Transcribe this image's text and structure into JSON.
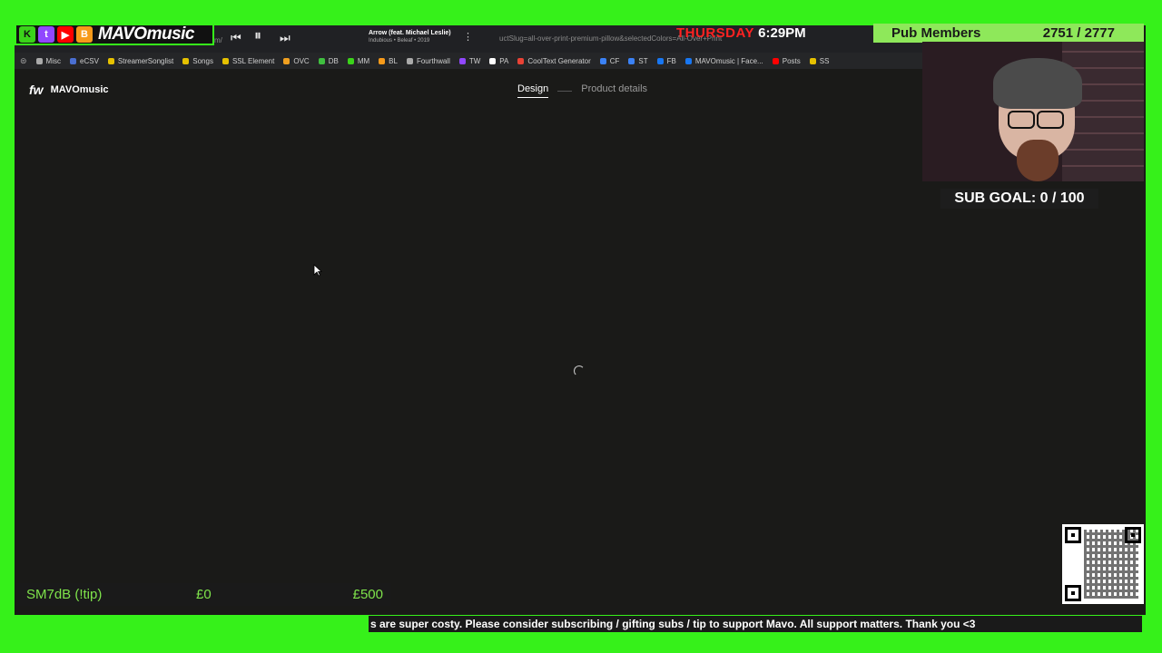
{
  "brand": {
    "name": "MAVOmusic",
    "icons": [
      "kick-icon",
      "twitch-icon",
      "youtube-icon",
      "b-icon"
    ],
    "colors": {
      "border": "#36f11a",
      "kick": "#3bd31a",
      "twitch": "#9147ff",
      "youtube": "#ff0000",
      "b": "#f79a1a"
    }
  },
  "player": {
    "song": "Arrow (feat. Michael Leslie)",
    "artist": "Indubious • Beleaf • 2019"
  },
  "browser": {
    "url_fragment": "uctSlug=all-over-print-premium-pillow&selectedColors=All-Over+Print",
    "url_prefix": "m/",
    "bookmarks": [
      {
        "label": "Misc",
        "icon": "folder-icon",
        "color": "#aaaaaa"
      },
      {
        "label": "eCSV",
        "icon": "csv-icon",
        "color": "#4a6fd1"
      },
      {
        "label": "StreamerSonglist",
        "icon": "music-icon",
        "color": "#e6c100"
      },
      {
        "label": "Songs",
        "icon": "music-icon",
        "color": "#e6c100"
      },
      {
        "label": "SSL Element",
        "icon": "music-icon",
        "color": "#e6c100"
      },
      {
        "label": "OVC",
        "icon": "ovc-icon",
        "color": "#f0a020"
      },
      {
        "label": "DB",
        "icon": "db-icon",
        "color": "#3fbf3f"
      },
      {
        "label": "MM",
        "icon": "kick-icon",
        "color": "#3bd31a"
      },
      {
        "label": "BL",
        "icon": "b-icon",
        "color": "#f79a1a"
      },
      {
        "label": "Fourthwall",
        "icon": "folder-icon",
        "color": "#aaaaaa"
      },
      {
        "label": "TW",
        "icon": "twitch-icon",
        "color": "#9147ff"
      },
      {
        "label": "PA",
        "icon": "patreon-icon",
        "color": "#ffffff"
      },
      {
        "label": "CoolText Generator",
        "icon": "g-icon",
        "color": "#e94235"
      },
      {
        "label": "CF",
        "icon": "cf-icon",
        "color": "#3b82f6"
      },
      {
        "label": "ST",
        "icon": "st-icon",
        "color": "#3b82f6"
      },
      {
        "label": "FB",
        "icon": "facebook-icon",
        "color": "#1877f2"
      },
      {
        "label": "MAVOmusic | Face...",
        "icon": "facebook-icon",
        "color": "#1877f2"
      },
      {
        "label": "Posts",
        "icon": "youtube-icon",
        "color": "#ff0000"
      },
      {
        "label": "SS",
        "icon": "music-icon",
        "color": "#e6c100"
      }
    ]
  },
  "datetime": {
    "day": "THURSDAY",
    "time": "6:29PM"
  },
  "pub": {
    "label": "Pub Members",
    "count": "2751 / 2777"
  },
  "site": {
    "logo_mark": "fw",
    "store_name": "MAVOmusic",
    "steps": {
      "active": "Design",
      "inactive": "Product details"
    }
  },
  "sub_goal": "SUB GOAL: 0 / 100",
  "tip": {
    "label": "SM7dB (!tip)",
    "min": "£0",
    "max": "£500",
    "progress": 0
  },
  "ticker": "s are super costy. Please consider subscribing / gifting subs / tip to support Mavo. All support matters. Thank you <3"
}
